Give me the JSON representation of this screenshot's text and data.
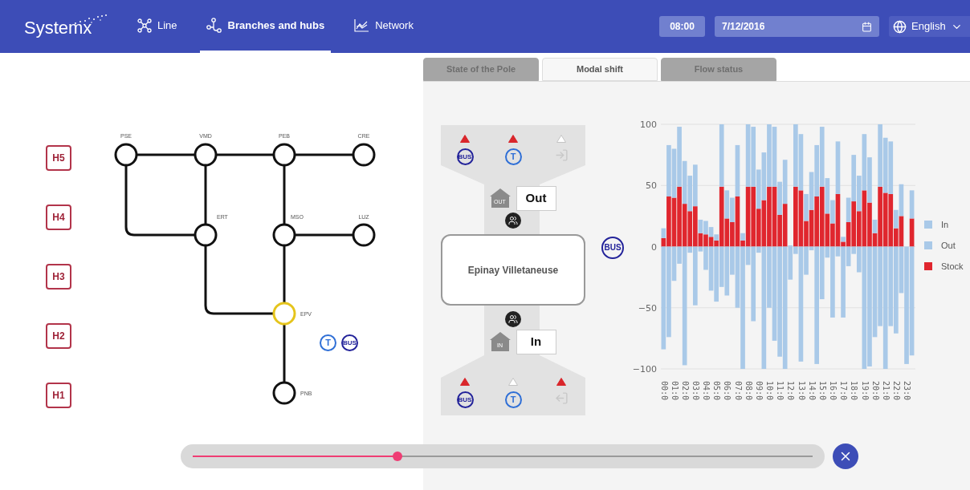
{
  "header": {
    "logo": "Systemx",
    "nav": [
      {
        "label": "Line",
        "selected": false
      },
      {
        "label": "Branches and hubs",
        "selected": true
      },
      {
        "label": "Network",
        "selected": false
      }
    ],
    "time": "08:00",
    "date": "7/12/2016",
    "language": "English"
  },
  "hour_buttons": [
    "H5",
    "H4",
    "H3",
    "H2",
    "H1"
  ],
  "network": {
    "stations": [
      {
        "code": "PSE",
        "selected": false
      },
      {
        "code": "VMD",
        "selected": false
      },
      {
        "code": "PEB",
        "selected": false
      },
      {
        "code": "CRE",
        "selected": false
      },
      {
        "code": "ERT",
        "selected": false
      },
      {
        "code": "MSO",
        "selected": false
      },
      {
        "code": "LUZ",
        "selected": false
      },
      {
        "code": "EPV",
        "selected": true
      },
      {
        "code": "PNB",
        "selected": false
      }
    ],
    "modes": [
      {
        "kind": "tram",
        "text": "T"
      },
      {
        "kind": "bus",
        "text": "BUS"
      }
    ]
  },
  "tabs": [
    {
      "label": "State of the Pole",
      "selected": false
    },
    {
      "label": "Modal shift",
      "selected": true
    },
    {
      "label": "Flow status",
      "selected": false
    }
  ],
  "hub": {
    "name": "Epinay Villetaneuse",
    "outbound": {
      "arrow": "OUT",
      "label": "Out",
      "modes": [
        {
          "kind": "bus",
          "text": "BUS",
          "rising": true
        },
        {
          "kind": "tram",
          "text": "T",
          "rising": true
        },
        {
          "kind": "exit",
          "rising": false
        }
      ]
    },
    "inbound": {
      "arrow": "IN",
      "label": "In",
      "modes": [
        {
          "kind": "bus",
          "text": "BUS",
          "rising": true
        },
        {
          "kind": "tram",
          "text": "T",
          "rising": false
        },
        {
          "kind": "entry",
          "rising": true
        }
      ]
    }
  },
  "side_mode": {
    "kind": "bus",
    "text": "BUS"
  },
  "chart_data": {
    "type": "bar",
    "stacked": true,
    "grid": true,
    "legend": true,
    "ylim": [
      -100,
      100
    ],
    "yticks": [
      {
        "value": -100,
        "label": "−100"
      },
      {
        "value": -50,
        "label": "−50"
      },
      0,
      50,
      100
    ],
    "categories": [
      "00:0",
      null,
      "01:0",
      null,
      "02:0",
      null,
      "03:0",
      null,
      "04:0",
      null,
      "05:0",
      null,
      "06:0",
      null,
      "07:0",
      null,
      "08:0",
      null,
      "09:0",
      null,
      "10:0",
      null,
      "11:0",
      null,
      "12:0",
      null,
      "13:0",
      null,
      "14:0",
      null,
      "15:0",
      null,
      "16:0",
      null,
      "17:0",
      null,
      "18:0",
      null,
      "19:0",
      null,
      "20:0",
      null,
      "21:0",
      null,
      "22:0",
      null,
      "23:0",
      null
    ],
    "series": [
      {
        "name": "In",
        "color": "#a9c9e8",
        "values": [
          8,
          42,
          40,
          49,
          35,
          29,
          34,
          11,
          11,
          8,
          5,
          51,
          23,
          20,
          42,
          6,
          51,
          49,
          32,
          39,
          51,
          49,
          27,
          36,
          1,
          51,
          46,
          22,
          31,
          42,
          49,
          29,
          19,
          43,
          4,
          20,
          38,
          29,
          46,
          37,
          11,
          51,
          45,
          43,
          15,
          26,
          0,
          23
        ]
      },
      {
        "name": "Out",
        "color": "#a9c9e8",
        "values": [
          -84,
          -74,
          -28,
          -14,
          -97,
          -5,
          -48,
          -4,
          -19,
          -36,
          -45,
          -33,
          -40,
          -23,
          -50,
          -100,
          -15,
          -61,
          -5,
          -100,
          -50,
          -77,
          -90,
          -100,
          -27,
          -6,
          -94,
          -23,
          -3,
          -96,
          -43,
          -9,
          -58,
          -8,
          -58,
          -16,
          -6,
          -21,
          -100,
          -98,
          -74,
          -65,
          -100,
          -65,
          -71,
          -38,
          -96,
          -89
        ]
      },
      {
        "name": "Stock",
        "color": "#e0262e",
        "values": [
          7,
          41,
          40,
          49,
          35,
          29,
          33,
          11,
          10,
          8,
          5,
          49,
          23,
          20,
          41,
          5,
          49,
          49,
          31,
          38,
          49,
          49,
          26,
          35,
          0,
          49,
          46,
          21,
          30,
          41,
          49,
          27,
          19,
          43,
          4,
          20,
          37,
          29,
          46,
          36,
          11,
          49,
          44,
          43,
          15,
          25,
          0,
          23
        ]
      }
    ]
  },
  "timeline": {
    "level": 0.33
  }
}
